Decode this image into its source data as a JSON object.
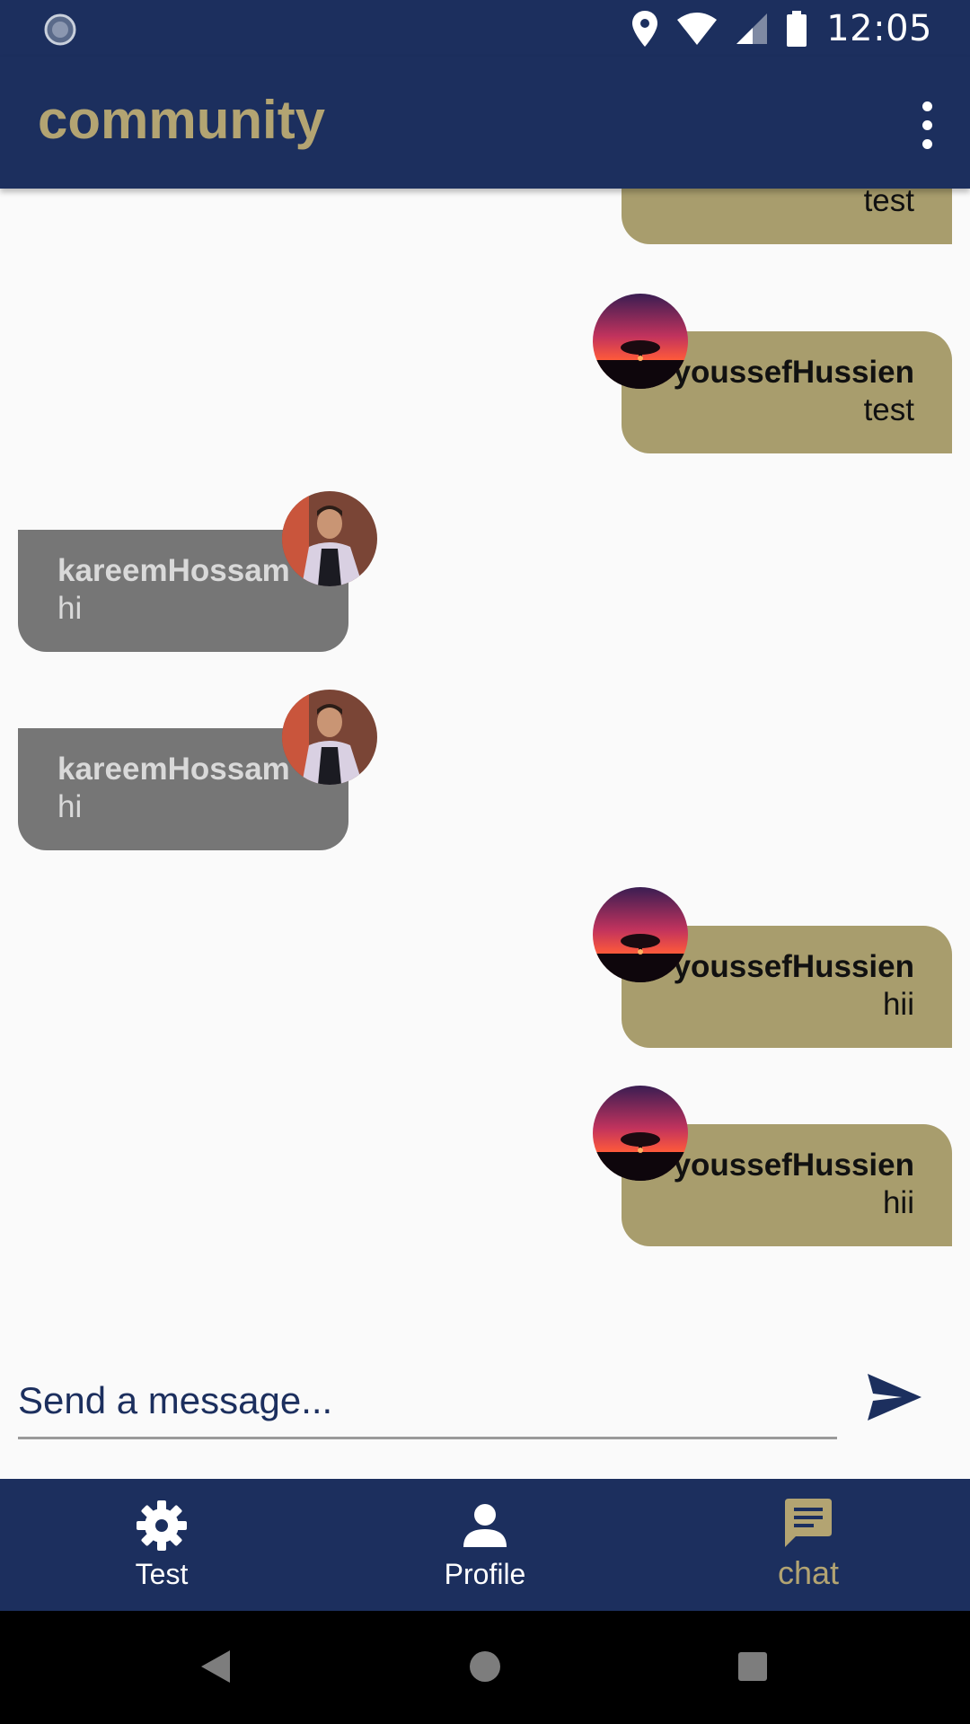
{
  "status_bar": {
    "time": "12:05",
    "icons": [
      "loading-circle-icon",
      "location-pin-icon",
      "wifi-icon",
      "cell-signal-icon",
      "battery-icon"
    ]
  },
  "app_bar": {
    "title": "community",
    "overflow_icon": "more-vert-icon"
  },
  "colors": {
    "primary": "#1c2f5e",
    "accent": "#b3a472",
    "own_bubble": "#a89d6d",
    "other_bubble": "#767676"
  },
  "messages": [
    {
      "sender": "",
      "text": "test",
      "side": "right"
    },
    {
      "sender": "youssefHussien",
      "text": "test",
      "side": "right"
    },
    {
      "sender": "kareemHossam",
      "text": "hi",
      "side": "left"
    },
    {
      "sender": "kareemHossam",
      "text": "hi",
      "side": "left"
    },
    {
      "sender": "youssefHussien",
      "text": "hii",
      "side": "right"
    },
    {
      "sender": "youssefHussien",
      "text": "hii",
      "side": "right"
    }
  ],
  "composer": {
    "placeholder": "Send a message...",
    "send_icon": "send-icon"
  },
  "bottom_nav": {
    "items": [
      {
        "label": "Test",
        "icon": "settings-gear-icon",
        "active": false
      },
      {
        "label": "Profile",
        "icon": "person-icon",
        "active": false
      },
      {
        "label": "chat",
        "icon": "chat-icon",
        "active": true
      }
    ]
  },
  "system_nav": {
    "icons": [
      "back-icon",
      "home-icon",
      "recents-icon"
    ]
  }
}
